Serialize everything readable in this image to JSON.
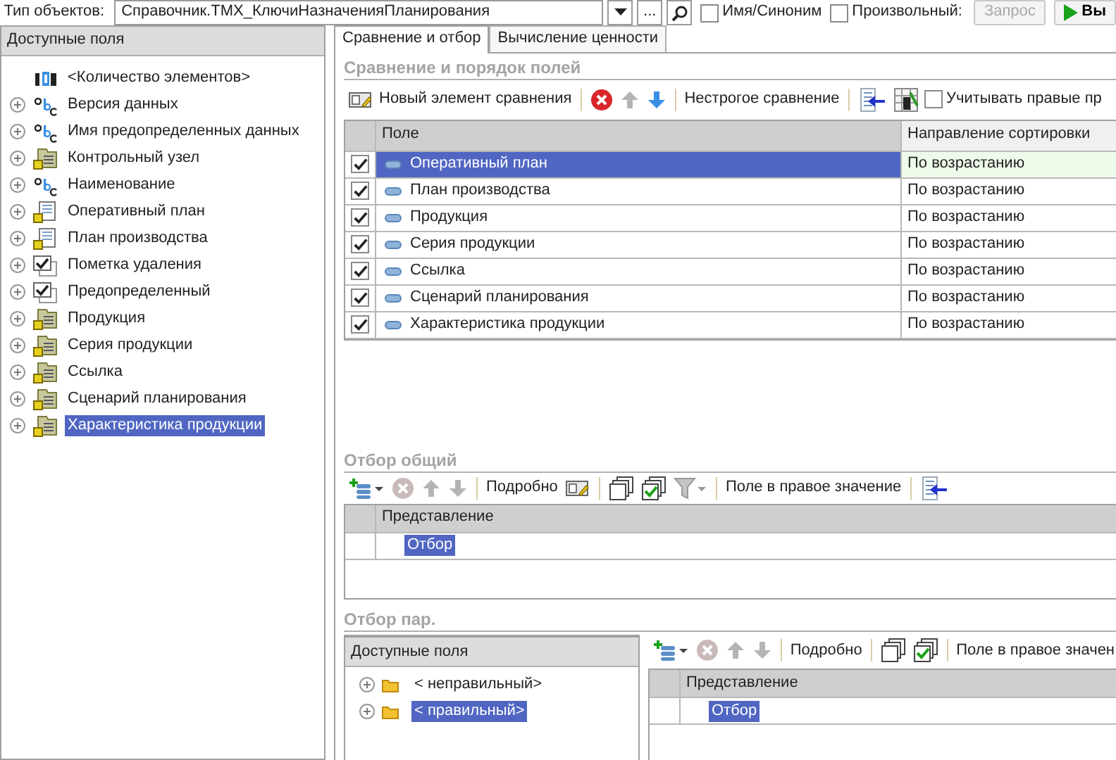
{
  "top_bar": {
    "label": "Тип объектов:",
    "object_type": "Справочник.ТМХ_КлючиНазначенияПланирования",
    "choose_button": "...",
    "checkboxes": [
      {
        "label": "Имя/Синоним",
        "checked": false
      },
      {
        "label": "Произвольный:",
        "checked": false
      }
    ],
    "query_button": {
      "label": "Запрос",
      "disabled": true
    },
    "run_button": {
      "label": "Вы"
    }
  },
  "available_fields": {
    "title": "Доступные поля",
    "items": [
      {
        "text": "<Количество элементов>",
        "kind": "number",
        "has_children": false,
        "selected": false
      },
      {
        "text": "Версия данных",
        "kind": "string",
        "has_children": true,
        "selected": false
      },
      {
        "text": "Имя предопределенных данных",
        "kind": "string",
        "has_children": true,
        "selected": false
      },
      {
        "text": "Контрольный узел",
        "kind": "reference",
        "has_children": true,
        "selected": false
      },
      {
        "text": "Наименование",
        "kind": "string",
        "has_children": true,
        "selected": false
      },
      {
        "text": "Оперативный план",
        "kind": "document",
        "has_children": true,
        "selected": false
      },
      {
        "text": "План производства",
        "kind": "document",
        "has_children": true,
        "selected": false
      },
      {
        "text": "Пометка удаления",
        "kind": "boolean",
        "has_children": true,
        "selected": false
      },
      {
        "text": "Предопределенный",
        "kind": "boolean",
        "has_children": true,
        "selected": false
      },
      {
        "text": "Продукция",
        "kind": "reference",
        "has_children": true,
        "selected": false
      },
      {
        "text": "Серия продукции",
        "kind": "reference",
        "has_children": true,
        "selected": false
      },
      {
        "text": "Ссылка",
        "kind": "reference",
        "has_children": true,
        "selected": false
      },
      {
        "text": "Сценарий планирования",
        "kind": "reference",
        "has_children": true,
        "selected": false
      },
      {
        "text": "Характеристика продукции",
        "kind": "reference",
        "has_children": true,
        "selected": true
      }
    ]
  },
  "tabs": [
    {
      "label": "Сравнение и отбор",
      "selected": true
    },
    {
      "label": "Вычисление ценности",
      "selected": false
    }
  ],
  "comparison": {
    "title": "Сравнение и порядок полей",
    "toolbar": [
      {
        "kind": "new",
        "text": "Новый элемент сравнения",
        "disabled": false
      },
      {
        "kind": "separator"
      },
      {
        "kind": "delete",
        "disabled": false
      },
      {
        "kind": "up",
        "disabled": true
      },
      {
        "kind": "down",
        "disabled": false
      },
      {
        "kind": "separator"
      },
      {
        "kind": "text",
        "text": "Нестрогое сравнение",
        "disabled": false
      },
      {
        "kind": "separator"
      },
      {
        "kind": "to-left"
      },
      {
        "kind": "grid"
      },
      {
        "kind": "checkbox",
        "text": "Учитывать правые пр",
        "checked": false
      }
    ],
    "columns": [
      "Поле",
      "Направление сортировки"
    ],
    "rows": [
      {
        "checked": true,
        "field": "Оперативный план",
        "sort": "По возрастанию",
        "selected": true
      },
      {
        "checked": true,
        "field": "План производства",
        "sort": "По возрастанию",
        "selected": false
      },
      {
        "checked": true,
        "field": "Продукция",
        "sort": "По возрастанию",
        "selected": false
      },
      {
        "checked": true,
        "field": "Серия продукции",
        "sort": "По возрастанию",
        "selected": false
      },
      {
        "checked": true,
        "field": "Ссылка",
        "sort": "По возрастанию",
        "selected": false
      },
      {
        "checked": true,
        "field": "Сценарий планирования",
        "sort": "По возрастанию",
        "selected": false
      },
      {
        "checked": true,
        "field": "Характеристика продукции",
        "sort": "По возрастанию",
        "selected": false
      }
    ]
  },
  "common_filter": {
    "title": "Отбор общий",
    "toolbar": [
      {
        "kind": "add"
      },
      {
        "kind": "delete",
        "disabled": true
      },
      {
        "kind": "up",
        "disabled": true
      },
      {
        "kind": "down",
        "disabled": true
      },
      {
        "kind": "separator"
      },
      {
        "kind": "text",
        "text": "Подробно",
        "disabled": false
      },
      {
        "kind": "card"
      },
      {
        "kind": "separator"
      },
      {
        "kind": "copy"
      },
      {
        "kind": "check-all"
      },
      {
        "kind": "filter",
        "disabled": true
      },
      {
        "kind": "separator"
      },
      {
        "kind": "text",
        "text": "Поле в правое значение",
        "disabled": false
      },
      {
        "kind": "separator"
      },
      {
        "kind": "to-left"
      }
    ],
    "columns": [
      "Представление"
    ],
    "rows": [
      {
        "text": "Отбор",
        "selected": true
      }
    ]
  },
  "pair_filter": {
    "title": "Отбор пар.",
    "fields": {
      "title": "Доступные поля",
      "items": [
        {
          "text": "< неправильный>",
          "selected": false
        },
        {
          "text": "< правильный>",
          "selected": true
        }
      ]
    },
    "toolbar": [
      {
        "kind": "add"
      },
      {
        "kind": "delete",
        "disabled": true
      },
      {
        "kind": "up",
        "disabled": true
      },
      {
        "kind": "down",
        "disabled": true
      },
      {
        "kind": "separator"
      },
      {
        "kind": "text",
        "text": "Подробно",
        "disabled": false
      },
      {
        "kind": "separator"
      },
      {
        "kind": "copy"
      },
      {
        "kind": "check-all"
      },
      {
        "kind": "separator"
      },
      {
        "kind": "text",
        "text": "Поле в правое значен",
        "disabled": false
      }
    ],
    "columns": [
      "Представление"
    ],
    "rows": [
      {
        "text": "Отбор",
        "selected": true
      }
    ]
  }
}
